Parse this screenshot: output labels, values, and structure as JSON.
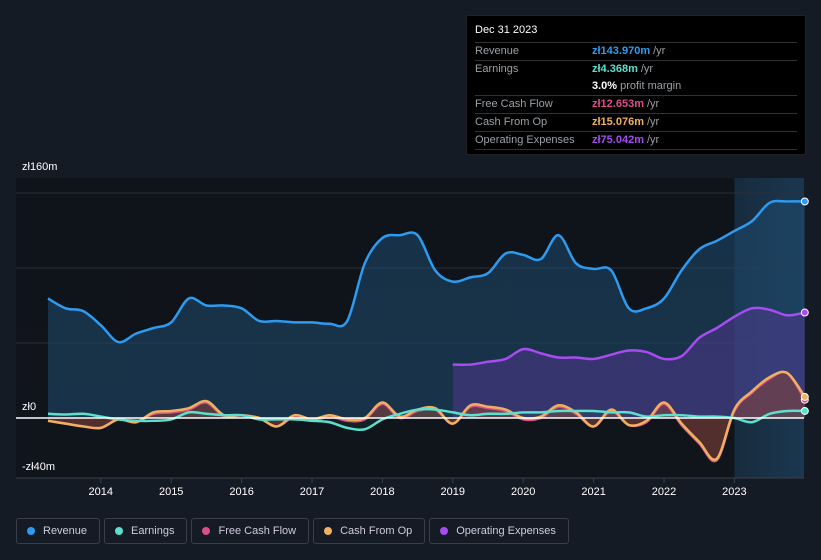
{
  "tooltip": {
    "date": "Dec 31 2023",
    "rows": [
      {
        "label": "Revenue",
        "value": "zł143.970m",
        "unit": "/yr",
        "color": "#2d9bf0"
      },
      {
        "label": "Earnings",
        "value": "zł4.368m",
        "unit": "/yr",
        "color": "#5ce0cc"
      },
      {
        "label": "",
        "value": "3.0%",
        "unit": "profit margin",
        "color": "#ffffff"
      },
      {
        "label": "Free Cash Flow",
        "value": "zł12.653m",
        "unit": "/yr",
        "color": "#d94f8a"
      },
      {
        "label": "Cash From Op",
        "value": "zł15.076m",
        "unit": "/yr",
        "color": "#f0b060"
      },
      {
        "label": "Operating Expenses",
        "value": "zł75.042m",
        "unit": "/yr",
        "color": "#a64cf0"
      }
    ]
  },
  "legend": [
    {
      "label": "Revenue",
      "color": "#2d9bf0"
    },
    {
      "label": "Earnings",
      "color": "#5ce0cc"
    },
    {
      "label": "Free Cash Flow",
      "color": "#d94f8a"
    },
    {
      "label": "Cash From Op",
      "color": "#f0b060"
    },
    {
      "label": "Operating Expenses",
      "color": "#a64cf0"
    }
  ],
  "chart_data": {
    "type": "line",
    "title": "",
    "xlabel": "",
    "ylabel": "",
    "y_tick_labels": [
      "zł160m",
      "zł0",
      "-zł40m"
    ],
    "ylim": [
      -40,
      160
    ],
    "xlim": [
      2013.25,
      2024.0
    ],
    "x_ticks": [
      "2014",
      "2015",
      "2016",
      "2017",
      "2018",
      "2019",
      "2020",
      "2021",
      "2022",
      "2023"
    ],
    "grid": true,
    "highlight_from": 2023.0,
    "series": [
      {
        "name": "Revenue",
        "color": "#2d9bf0",
        "x": [
          2013.25,
          2013.5,
          2013.75,
          2014.0,
          2014.25,
          2014.5,
          2014.75,
          2015.0,
          2015.25,
          2015.5,
          2015.75,
          2016.0,
          2016.25,
          2016.5,
          2016.75,
          2017.0,
          2017.25,
          2017.5,
          2017.75,
          2018.0,
          2018.25,
          2018.5,
          2018.75,
          2019.0,
          2019.25,
          2019.5,
          2019.75,
          2020.0,
          2020.25,
          2020.5,
          2020.75,
          2021.0,
          2021.25,
          2021.5,
          2021.75,
          2022.0,
          2022.25,
          2022.5,
          2022.75,
          2023.0,
          2023.25,
          2023.5,
          2023.75,
          2024.0
        ],
        "values": [
          85,
          78,
          76,
          66,
          54,
          60,
          64,
          68,
          85,
          80,
          80,
          78,
          69,
          69,
          68,
          68,
          67,
          69,
          110,
          128,
          130,
          130,
          105,
          97,
          100,
          103,
          117,
          116,
          113,
          130,
          110,
          106,
          105,
          78,
          78,
          85,
          105,
          120,
          126,
          133,
          140,
          153,
          154,
          154
        ]
      },
      {
        "name": "Earnings",
        "color": "#5ce0cc",
        "x": [
          2013.25,
          2013.5,
          2013.75,
          2014.0,
          2014.25,
          2014.5,
          2014.75,
          2015.0,
          2015.25,
          2015.5,
          2015.75,
          2016.0,
          2016.25,
          2016.5,
          2016.75,
          2017.0,
          2017.25,
          2017.5,
          2017.75,
          2018.0,
          2018.25,
          2018.5,
          2018.75,
          2019.0,
          2019.25,
          2019.5,
          2019.75,
          2020.0,
          2020.25,
          2020.5,
          2020.75,
          2021.0,
          2021.25,
          2021.5,
          2021.75,
          2022.0,
          2022.25,
          2022.5,
          2022.75,
          2023.0,
          2023.25,
          2023.5,
          2023.75,
          2024.0
        ],
        "values": [
          3,
          2.5,
          3,
          1,
          -1,
          -2,
          -2,
          -1,
          4,
          3,
          2,
          2,
          -1,
          -1,
          -1,
          -2,
          -3,
          -7,
          -8,
          -1,
          3,
          6,
          6,
          4,
          2,
          3,
          3,
          4,
          4,
          5,
          5,
          5,
          4,
          4,
          1,
          2,
          2,
          1,
          1,
          0,
          -3,
          3,
          5,
          5
        ]
      },
      {
        "name": "Free Cash Flow",
        "color": "#d94f8a",
        "x": [
          2013.25,
          2013.5,
          2013.75,
          2014.0,
          2014.25,
          2014.5,
          2014.75,
          2015.0,
          2015.25,
          2015.5,
          2015.75,
          2016.0,
          2016.25,
          2016.5,
          2016.75,
          2017.0,
          2017.25,
          2017.5,
          2017.75,
          2018.0,
          2018.25,
          2018.5,
          2018.75,
          2019.0,
          2019.25,
          2019.5,
          2019.75,
          2020.0,
          2020.25,
          2020.5,
          2020.75,
          2021.0,
          2021.25,
          2021.5,
          2021.75,
          2022.0,
          2022.25,
          2022.5,
          2022.75,
          2023.0,
          2023.25,
          2023.5,
          2023.75,
          2024.0
        ],
        "values": [
          -2,
          -4,
          -6,
          -7,
          -1,
          -3,
          3,
          4,
          6,
          11,
          1,
          2,
          0,
          -6,
          1,
          -2,
          1,
          -2,
          -1,
          10,
          0,
          5,
          6,
          -4,
          8,
          7,
          5,
          -1,
          0,
          8,
          3,
          -6,
          5,
          -5,
          -3,
          10,
          -5,
          -18,
          -30,
          5,
          18,
          28,
          32,
          13
        ]
      },
      {
        "name": "Cash From Op",
        "color": "#f0b060",
        "x": [
          2013.25,
          2013.5,
          2013.75,
          2014.0,
          2014.25,
          2014.5,
          2014.75,
          2015.0,
          2015.25,
          2015.5,
          2015.75,
          2016.0,
          2016.25,
          2016.5,
          2016.75,
          2017.0,
          2017.25,
          2017.5,
          2017.75,
          2018.0,
          2018.25,
          2018.5,
          2018.75,
          2019.0,
          2019.25,
          2019.5,
          2019.75,
          2020.0,
          2020.25,
          2020.5,
          2020.75,
          2021.0,
          2021.25,
          2021.5,
          2021.75,
          2022.0,
          2022.25,
          2022.5,
          2022.75,
          2023.0,
          2023.25,
          2023.5,
          2023.75,
          2024.0
        ],
        "values": [
          -2,
          -4,
          -6,
          -7,
          -1,
          -3,
          4,
          5,
          7,
          12,
          2,
          2,
          0,
          -6,
          2,
          -1,
          2,
          -1,
          0,
          11,
          1,
          6,
          7,
          -4,
          9,
          8,
          6,
          0,
          1,
          9,
          4,
          -6,
          6,
          -5,
          -2,
          11,
          -4,
          -17,
          -29,
          6,
          19,
          29,
          32,
          15
        ]
      },
      {
        "name": "Operating Expenses",
        "color": "#a64cf0",
        "x": [
          2019.0,
          2019.25,
          2019.5,
          2019.75,
          2020.0,
          2020.25,
          2020.5,
          2020.75,
          2021.0,
          2021.25,
          2021.5,
          2021.75,
          2022.0,
          2022.25,
          2022.5,
          2022.75,
          2023.0,
          2023.25,
          2023.5,
          2023.75,
          2024.0
        ],
        "values": [
          38,
          38,
          40,
          42,
          49,
          46,
          43,
          43,
          42,
          45,
          48,
          47,
          42,
          44,
          57,
          64,
          72,
          78,
          77,
          73,
          75
        ]
      }
    ]
  }
}
